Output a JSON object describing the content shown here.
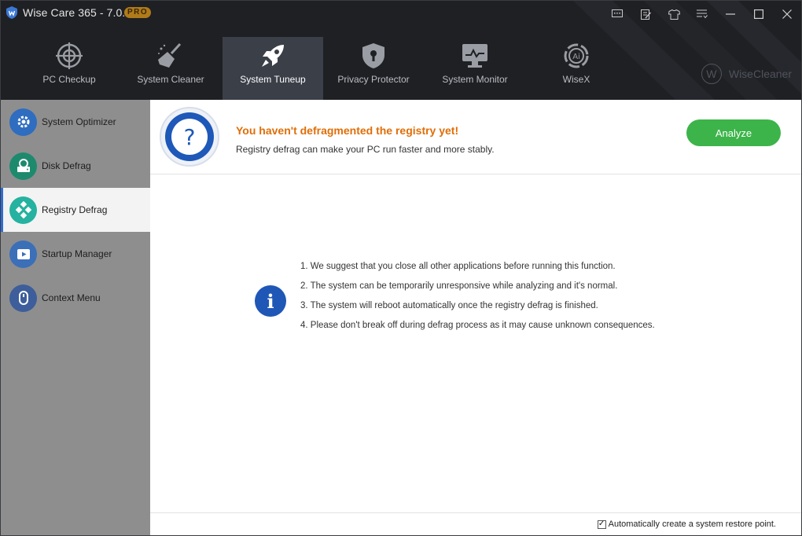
{
  "window": {
    "title": "Wise Care 365 - 7.0.4",
    "badge": "PRO",
    "title_icons": [
      "feedback-icon",
      "notes-icon",
      "skin-icon",
      "menu-icon",
      "minimize-icon",
      "maximize-icon",
      "close-icon"
    ]
  },
  "nav": {
    "items": [
      {
        "label": "PC Checkup",
        "icon": "crosshair-icon"
      },
      {
        "label": "System Cleaner",
        "icon": "broom-icon"
      },
      {
        "label": "System Tuneup",
        "icon": "rocket-icon",
        "active": true
      },
      {
        "label": "Privacy Protector",
        "icon": "shield-lock-icon"
      },
      {
        "label": "System Monitor",
        "icon": "monitor-icon"
      },
      {
        "label": "WiseX",
        "icon": "wisex-icon"
      }
    ],
    "brand": "WiseCleaner"
  },
  "sidebar": {
    "items": [
      {
        "label": "System Optimizer",
        "icon": "gear-icon",
        "color": "#2e6dbf"
      },
      {
        "label": "Disk Defrag",
        "icon": "disk-icon",
        "color": "#1d8a6e"
      },
      {
        "label": "Registry Defrag",
        "icon": "registry-icon",
        "color": "#25b2a0",
        "active": true
      },
      {
        "label": "Startup Manager",
        "icon": "startup-icon",
        "color": "#3b6fb8"
      },
      {
        "label": "Context Menu",
        "icon": "mouse-icon",
        "color": "#3d5e9a"
      }
    ]
  },
  "header": {
    "title": "You haven't defragmented the registry yet!",
    "subtitle": "Registry defrag can make your PC run faster and more stably.",
    "analyze_label": "Analyze"
  },
  "tips": [
    "1. We suggest that you close all other applications before running this function.",
    "2. The system can be temporarily unresponsive while analyzing and it's normal.",
    "3. The system will reboot automatically once the registry defrag is finished.",
    "4. Please don't break off during defrag process as it may cause unknown consequences."
  ],
  "footer": {
    "restore_label": "Automatically create a system restore point.",
    "restore_checked": true
  },
  "colors": {
    "accent_orange": "#e06e07",
    "analyze_green": "#3cb44a",
    "info_blue": "#1f57b6",
    "nav_active": "#3b3f48"
  }
}
